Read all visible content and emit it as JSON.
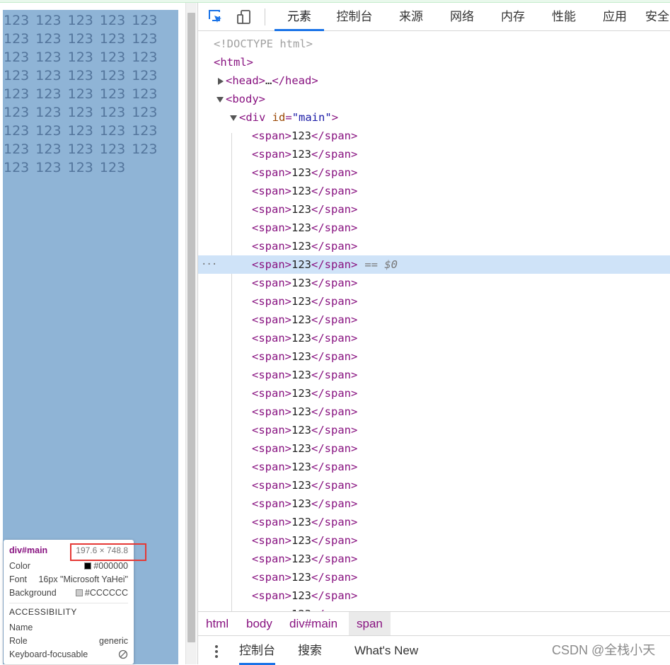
{
  "page": {
    "main_content": "123 123 123 123 123 123 123 123 123 123 123 123 123 123 123 123 123 123 123 123 123 123 123 123 123 123 123 123 123 123 123 123 123 123 123 123 123 123 123 123 123 123 123 123"
  },
  "tooltip": {
    "element": "div#main",
    "dimensions": "197.6 × 748.8",
    "color_label": "Color",
    "color_value": "#000000",
    "color_swatch": "#000000",
    "font_label": "Font",
    "font_value": "16px \"Microsoft YaHei\"",
    "background_label": "Background",
    "background_value": "#CCCCCC",
    "background_swatch": "#CCCCCC",
    "accessibility_heading": "ACCESSIBILITY",
    "name_label": "Name",
    "name_value": "",
    "role_label": "Role",
    "role_value": "generic",
    "focusable_label": "Keyboard-focusable"
  },
  "devtools": {
    "tabs": [
      "元素",
      "控制台",
      "来源",
      "网络",
      "内存",
      "性能",
      "应用",
      "安全"
    ],
    "active_tab": "元素",
    "dom": {
      "doctype": "<!DOCTYPE html>",
      "html_open": "<html>",
      "head_open": "<head>",
      "head_ellipsis": "…",
      "head_close": "</head>",
      "body_open": "<body>",
      "div_open_start": "<div ",
      "div_attr_name": "id",
      "div_attr_eq": "=",
      "div_attr_value": "\"main\"",
      "div_open_end": ">",
      "span_open": "<span>",
      "span_text": "123",
      "span_close": "</span>",
      "selected_marker": "== $0",
      "row_dots": "···"
    },
    "breadcrumbs": [
      "html",
      "body",
      "div#main",
      "span"
    ],
    "drawer_tabs": [
      "控制台",
      "搜索",
      "What's New"
    ],
    "watermark": "CSDN @全栈小天"
  }
}
